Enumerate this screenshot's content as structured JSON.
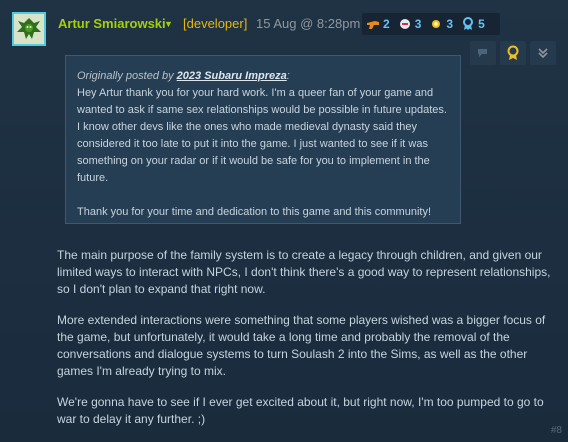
{
  "post": {
    "author": "Artur Smiarowski",
    "role": "[developer]",
    "date": "15 Aug @ 8:28pm",
    "post_number": "#8",
    "awards": [
      {
        "icon": "blaster-award-icon",
        "count": "2"
      },
      {
        "icon": "helmet-award-icon",
        "count": "3"
      },
      {
        "icon": "sun-award-icon",
        "count": "3"
      },
      {
        "icon": "ribbon-award-icon",
        "count": "5"
      }
    ]
  },
  "quote": {
    "prefix": "Originally posted by ",
    "quoted_author": "2023 Subaru Impreza",
    "suffix": ":",
    "paragraphs": [
      "Hey Artur thank you for your hard work. I'm a queer fan of your game and wanted to ask if same sex relationships would be possible in future updates. I know other devs like the ones who made medieval dynasty said they considered it too late to put it into the game. I just wanted to see if it was something on your radar or if it would be safe for you to implement in the future.",
      "Thank you for your time and dedication to this game and this community!"
    ]
  },
  "body": {
    "paragraphs": [
      "The main purpose of the family system is to create a legacy through children, and given our limited ways to interact with NPCs, I don't think there's a good way to represent relationships, so I don't plan to expand that right now.",
      "More extended interactions were something that some players wished was a bigger focus of the game, but unfortunately, it would take a long time and probably the removal of the conversations and dialogue systems to turn Soulash 2 into the Sims, as well as the other games I'm already trying to mix.",
      "We're gonna have to see if I ever get excited about it, but right now, I'm too pumped to go to war to delay it any further. ;)"
    ]
  },
  "colors": {
    "author": "#a4d007",
    "role": "#e5b80b",
    "accent": "#66c0f4",
    "background": "#1b2838"
  }
}
